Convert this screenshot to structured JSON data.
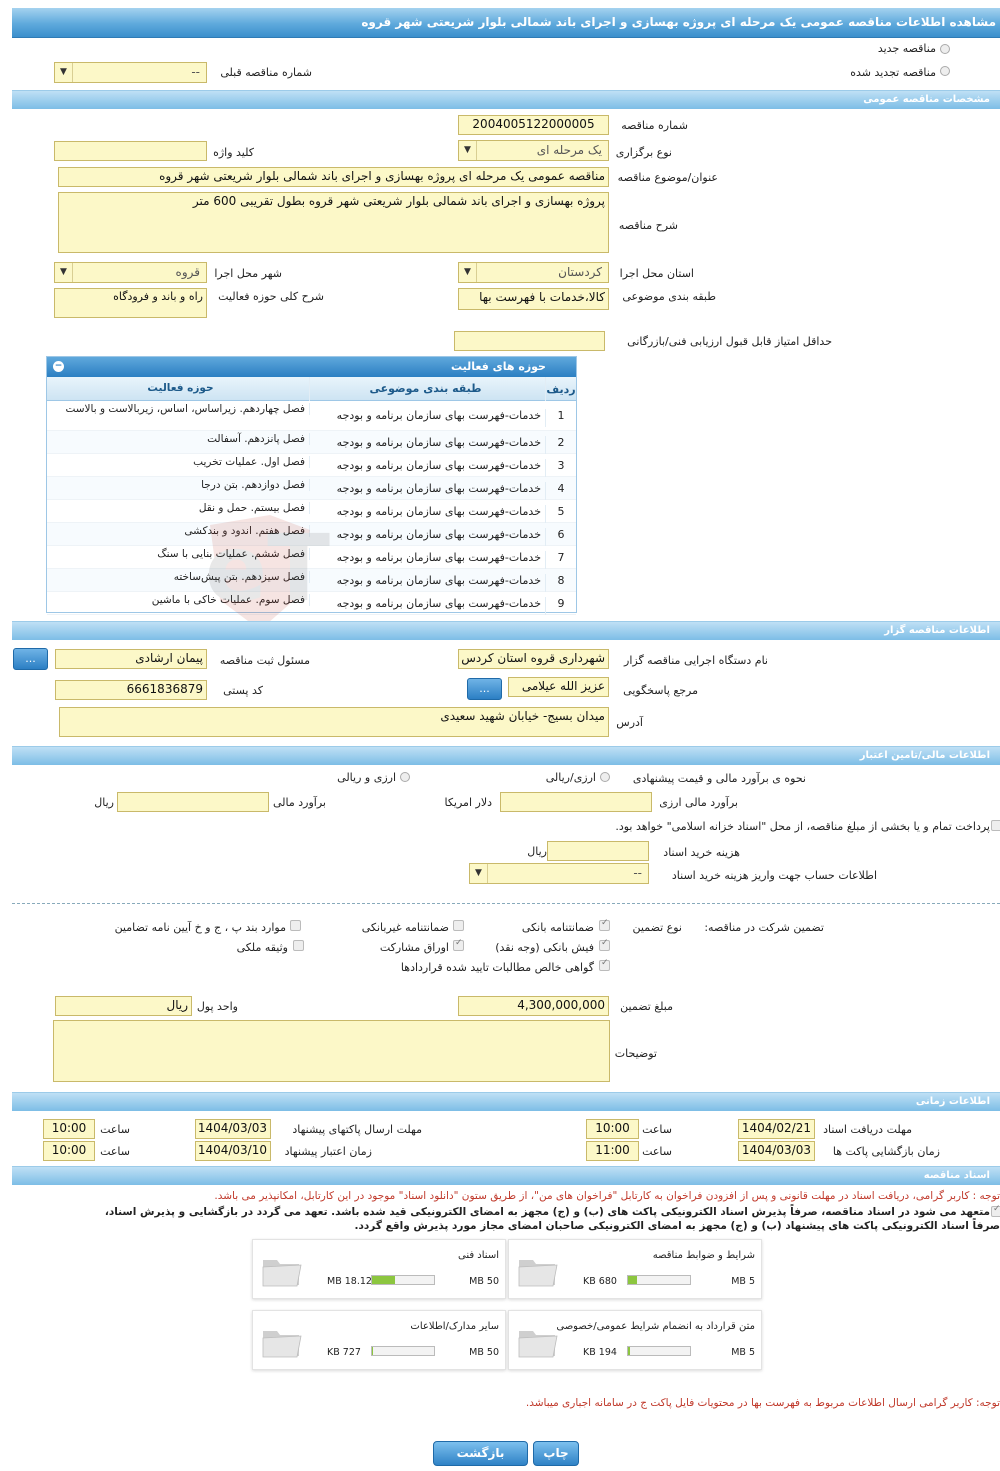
{
  "page_title": "مشاهده اطلاعات مناقصه عمومی یک مرحله ای پروژه بهسازی و اجرای باند شمالی بلوار شریعتی شهر قروه",
  "header_options": {
    "new_tender": "مناقصه جدید",
    "renewed_tender": "مناقصه تجدید شده",
    "previous_number_label": "شماره مناقصه قبلی",
    "previous_number_value": "--"
  },
  "general": {
    "section_title": "مشخصات مناقصه عمومی",
    "number_label": "شماره مناقصه",
    "number_value": "2004005122000005",
    "type_label": "نوع برگزاری",
    "type_value": "یک مرحله ای",
    "keyword_label": "کلید واژه",
    "keyword_value": "",
    "title_label": "عنوان/موضوع مناقصه",
    "title_value": "مناقصه عمومی یک مرحله ای پروژه بهسازی و اجرای باند شمالی بلوار شریعتی شهر قروه",
    "desc_label": "شرح مناقصه",
    "desc_value": "پروژه بهسازی و اجرای باند شمالی بلوار شریعتی شهر قروه بطول تقریبی 600 متر",
    "province_label": "استان محل اجرا",
    "province_value": "کردستان",
    "city_label": "شهر محل اجرا",
    "city_value": "قروه",
    "category_label": "طبقه بندی موضوعی",
    "category_value": "کالا،خدمات با فهرست بها",
    "activity_desc_label": "شرح کلی حوزه فعالیت",
    "activity_desc_value": "راه و باند و فرودگاه",
    "min_score_label": "حداقل امتیاز قابل قبول ارزیابی فنی/بازرگانی",
    "min_score_value": ""
  },
  "activity_grid": {
    "title": "حوزه های فعالیت",
    "headers": {
      "row": "ردیف",
      "category": "طبقه بندی موضوعی",
      "field": "حوزه فعالیت"
    },
    "rows": [
      {
        "n": "1",
        "cat": "خدمات-فهرست بهای سازمان برنامه و بودجه",
        "field": "فصل چهاردهم. زیراساس، اساس، زیربالاست و بالاست"
      },
      {
        "n": "2",
        "cat": "خدمات-فهرست بهای سازمان برنامه و بودجه",
        "field": "فصل پانزدهم. آسفالت"
      },
      {
        "n": "3",
        "cat": "خدمات-فهرست بهای سازمان برنامه و بودجه",
        "field": "فصل اول. عملیات تخریب"
      },
      {
        "n": "4",
        "cat": "خدمات-فهرست بهای سازمان برنامه و بودجه",
        "field": "فصل دوازدهم. بتن درجا"
      },
      {
        "n": "5",
        "cat": "خدمات-فهرست بهای سازمان برنامه و بودجه",
        "field": "فصل بیستم. حمل و نقل"
      },
      {
        "n": "6",
        "cat": "خدمات-فهرست بهای سازمان برنامه و بودجه",
        "field": "فصل هفتم. اندود و بندکشی"
      },
      {
        "n": "7",
        "cat": "خدمات-فهرست بهای سازمان برنامه و بودجه",
        "field": "فصل ششم. عملیات بنایی با سنگ"
      },
      {
        "n": "8",
        "cat": "خدمات-فهرست بهای سازمان برنامه و بودجه",
        "field": "فصل سیزدهم. بتن پیش‌ساخته"
      },
      {
        "n": "9",
        "cat": "خدمات-فهرست بهای سازمان برنامه و بودجه",
        "field": "فصل سوم. عملیات خاکی با ماشین"
      }
    ]
  },
  "organizer": {
    "section_title": "اطلاعات مناقصه گزار",
    "org_label": "نام دستگاه اجرایی مناقصه گزار",
    "org_value": "شهرداری قروه استان کردس",
    "registrar_label": "مسئول ثبت مناقصه",
    "registrar_value": "پیمان  ارشادی",
    "responder_label": "مرجع پاسخگویی",
    "responder_value": "عزیز الله عیلامی",
    "postal_label": "کد پستی",
    "postal_value": "6661836879",
    "address_label": "آدرس",
    "address_value": "میدان بسیج- خیابان شهید سعیدی",
    "dots": "..."
  },
  "finance": {
    "section_title": "اطلاعات مالی/تامین اعتبار",
    "method_label": "نحوه ی برآورد مالی و قیمت پیشنهادی",
    "opt_currency_rial": "ارزی/ریالی",
    "opt_currency_and_rial": "ارزی و ریالی",
    "fx_estimate_label": "برآورد مالی ارزی",
    "fx_unit": "دلار امریکا",
    "estimate_label": "برآورد مالی",
    "estimate_unit": "ریال",
    "treasury_note": "پرداخت تمام و یا بخشی از مبلغ مناقصه، از محل \"اسناد خزانه اسلامی\" خواهد بود.",
    "doc_fee_label": "هزینه خرید اسناد",
    "doc_fee_unit": "ریال",
    "account_label": "اطلاعات حساب جهت واریز هزینه خرید اسناد",
    "account_value": "--"
  },
  "guarantee": {
    "label": "تضمین شرکت در مناقصه:",
    "type_label": "نوع تضمین",
    "options": {
      "bank_guarantee": "ضمانتنامه بانکی",
      "non_bank_guarantee": "ضمانتنامه غیربانکی",
      "clauses": "موارد بند پ ، ج و خ آیین نامه تضامین",
      "bank_receipt": "فیش بانکی (وجه نقد)",
      "bonds": "اوراق مشارکت",
      "property": "وثیقه ملکی",
      "receivables": "گواهی خالص مطالبات تایید شده قراردادها"
    },
    "amount_label": "مبلغ تضمین",
    "amount_value": "4,300,000,000",
    "currency_label": "واحد پول",
    "currency_value": "ریال",
    "notes_label": "توضیحات",
    "notes_value": ""
  },
  "timing": {
    "section_title": "اطلاعات زمانی",
    "doc_deadline_label": "مهلت دریافت اسناد",
    "doc_deadline_date": "1404/02/21",
    "doc_deadline_time": "10:00",
    "submit_deadline_label": "مهلت ارسال پاکتهای پیشنهاد",
    "submit_deadline_date": "1404/03/03",
    "submit_deadline_time": "10:00",
    "opening_label": "زمان بازگشایی پاکت ها",
    "opening_date": "1404/03/03",
    "opening_time": "11:00",
    "validity_label": "زمان اعتبار پیشنهاد",
    "validity_date": "1404/03/10",
    "validity_time": "10:00",
    "time_label": "ساعت"
  },
  "documents": {
    "section_title": "اسناد مناقصه",
    "notice1": "توجه : کاربر گرامی، دریافت اسناد در مهلت قانونی و پس از افزودن فراخوان به کارتابل \"فراخوان های من\"، از طریق ستون \"دانلود اسناد\" موجود در این کارتابل، امکانپذیر می باشد.",
    "commit_line1": "متعهد می شود در اسناد مناقصه، صرفاً پذیرش اسناد الکترونیکی پاکت های (ب) و (ج) مجهز به امضای الکترونیکی قید شده باشد. تعهد می گردد در بازگشایی و پذیرش اسناد،",
    "commit_line2": "صرفاً اسناد الکترونیکی پاکت های پیشنهاد (ب) و (ج) مجهز به امضای الکترونیکی صاحبان امضای مجاز مورد پذیرش واقع گردد.",
    "files": [
      {
        "name": "شرایط و ضوابط مناقصه",
        "size": "680 KB",
        "max": "5 MB",
        "fill": 0.14
      },
      {
        "name": "اسناد فنی",
        "size": "18.12 MB",
        "max": "50 MB",
        "fill": 0.37
      },
      {
        "name": "متن قرارداد به انضمام شرایط عمومی/خصوصی",
        "size": "194 KB",
        "max": "5 MB",
        "fill": 0.04
      },
      {
        "name": "سایر مدارک/اطلاعات",
        "size": "727 KB",
        "max": "50 MB",
        "fill": 0.02
      }
    ],
    "notice2": "توجه: کاربر گرامی ارسال اطلاعات مربوط به فهرست بها در محتویات فایل پاکت ج در سامانه اجباری میباشد."
  },
  "actions": {
    "print": "چاپ",
    "back": "بازگشت"
  },
  "colors": {
    "accent": "#3b8fcc",
    "field_bg": "#fcf8c8",
    "notice": "#c0392b",
    "progress": "#8cc63f"
  }
}
